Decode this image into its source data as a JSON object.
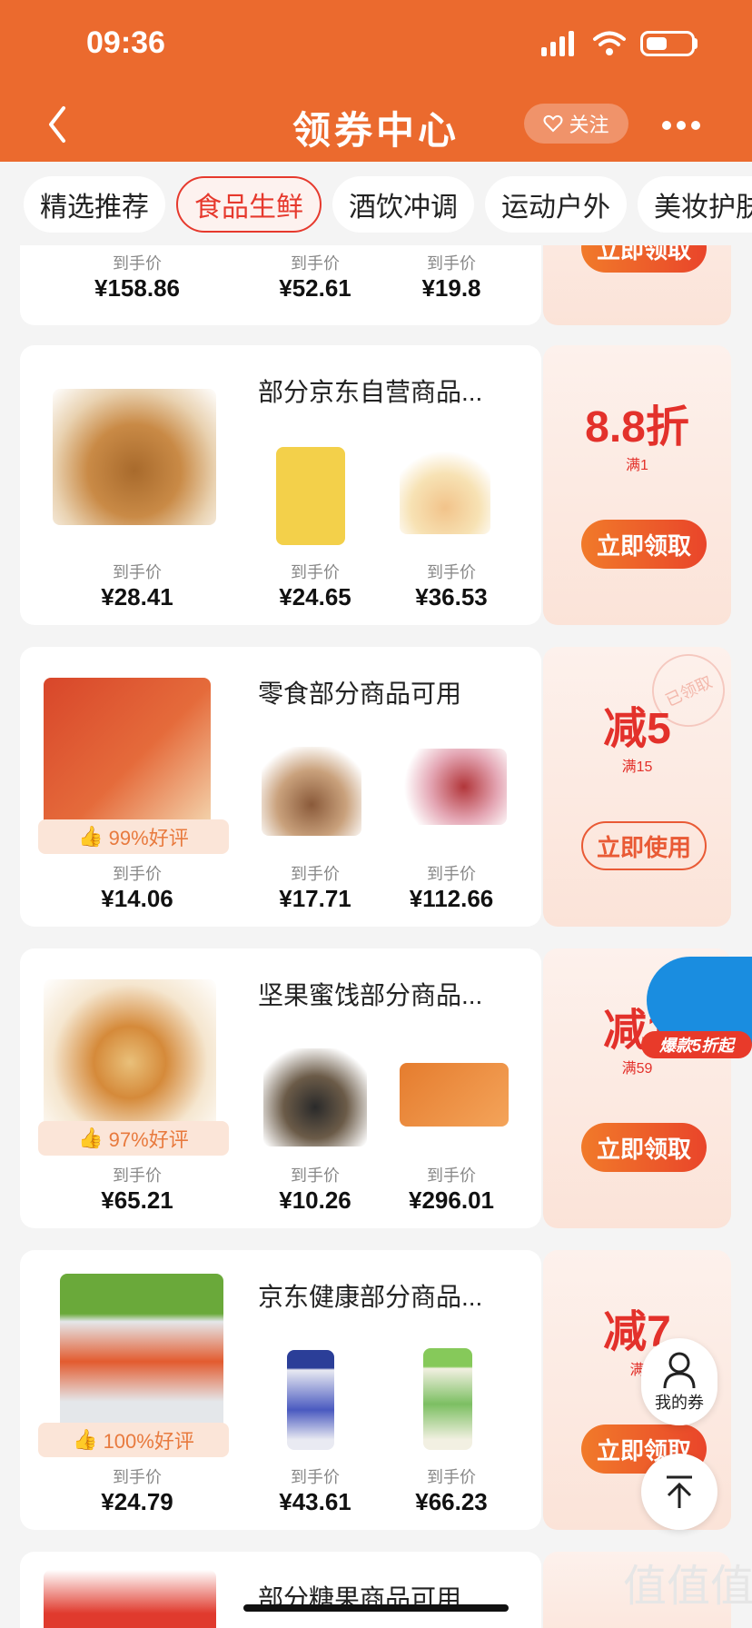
{
  "status": {
    "time": "09:36"
  },
  "nav": {
    "title": "领券中心",
    "follow": "关注"
  },
  "tabs": [
    "精选推荐",
    "食品生鲜",
    "酒饮冲调",
    "运动户外",
    "美妆护肤"
  ],
  "cards": [
    {
      "title": "",
      "prices": [
        "¥158.86",
        "¥52.61",
        "¥19.8"
      ],
      "price_label": "到手价",
      "button": "立即领取"
    },
    {
      "title": "部分京东自营商品...",
      "prices": [
        "¥28.41",
        "¥24.65",
        "¥36.53"
      ],
      "price_label": "到手价",
      "discount_main": "8.8折",
      "discount_sub": "满1",
      "button": "立即领取"
    },
    {
      "title": "零食部分商品可用",
      "prices": [
        "¥14.06",
        "¥17.71",
        "¥112.66"
      ],
      "price_label": "到手价",
      "rating": "99%好评",
      "discount_main": "减5",
      "discount_sub": "满15",
      "button": "立即使用",
      "stamp": "已领取"
    },
    {
      "title": "坚果蜜饯部分商品...",
      "prices": [
        "¥65.21",
        "¥10.26",
        "¥296.01"
      ],
      "price_label": "到手价",
      "rating": "97%好评",
      "discount_main": "减1",
      "discount_sub": "满59",
      "button": "立即领取"
    },
    {
      "title": "京东健康部分商品...",
      "prices": [
        "¥24.79",
        "¥43.61",
        "¥66.23"
      ],
      "price_label": "到手价",
      "rating": "100%好评",
      "discount_main": "减7",
      "discount_sub": "满",
      "button": "立即领取"
    },
    {
      "title": "部分糖果商品可用"
    }
  ],
  "floating": {
    "promo": "爆款5折起",
    "my_coupons": "我的券"
  },
  "colors": {
    "brand": "#eb6a2e",
    "accent_red": "#e3312b"
  }
}
